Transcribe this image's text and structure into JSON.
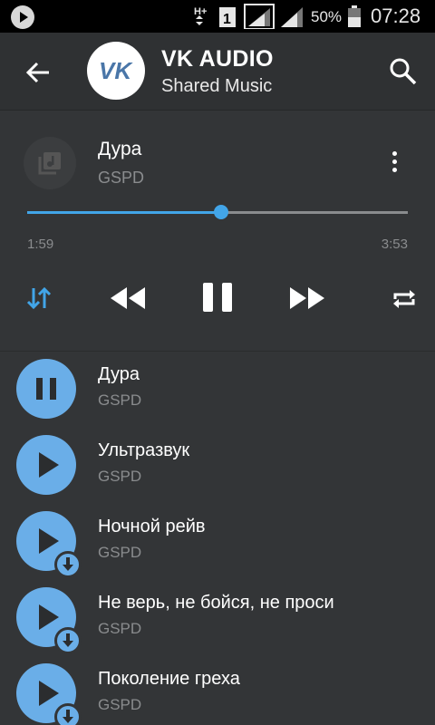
{
  "status_bar": {
    "network": "H+",
    "sim": "1",
    "battery_percent": "50%",
    "time": "07:28"
  },
  "header": {
    "title": "VK AUDIO",
    "subtitle": "Shared Music",
    "logo_text": "VK"
  },
  "now_playing": {
    "title": "Дура",
    "artist": "GSPD",
    "elapsed": "1:59",
    "duration": "3:53",
    "progress_fraction": 0.51,
    "accent_color": "#42a5e8"
  },
  "controls": {
    "sort_icon": "sort-arrows-icon",
    "rewind_icon": "rewind-icon",
    "pause_icon": "pause-icon",
    "forward_icon": "fast-forward-icon",
    "repeat_icon": "repeat-icon"
  },
  "tracks": [
    {
      "title": "Дура",
      "artist": "GSPD",
      "state": "playing",
      "downloaded": false
    },
    {
      "title": "Ультразвук",
      "artist": "GSPD",
      "state": "paused",
      "downloaded": false
    },
    {
      "title": "Ночной рейв",
      "artist": "GSPD",
      "state": "paused",
      "downloaded": true
    },
    {
      "title": "Не верь, не бойся, не проси",
      "artist": "GSPD",
      "state": "paused",
      "downloaded": true
    },
    {
      "title": "Поколение греха",
      "artist": "GSPD",
      "state": "paused",
      "downloaded": true
    }
  ],
  "colors": {
    "track_button": "#6aaee8",
    "background": "#333537"
  }
}
